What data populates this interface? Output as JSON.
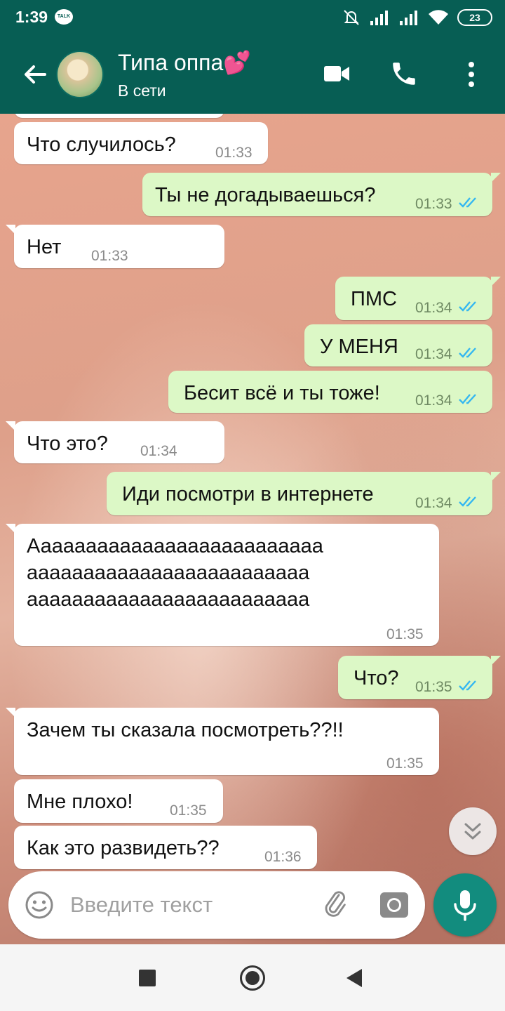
{
  "status_bar": {
    "time": "1:39",
    "talk_badge": "TALK",
    "battery": "23"
  },
  "header": {
    "contact_name": "Типа оппа💕",
    "contact_status": "В сети"
  },
  "messages": [
    {
      "dir": "in",
      "text": "Что случилось?",
      "time": "01:33"
    },
    {
      "dir": "out",
      "text": "Ты не догадываешься?",
      "time": "01:33",
      "read": true
    },
    {
      "dir": "in",
      "text": "Нет",
      "time": "01:33"
    },
    {
      "dir": "out",
      "text": "ПМС",
      "time": "01:34",
      "read": true
    },
    {
      "dir": "out",
      "text": "У МЕНЯ",
      "time": "01:34",
      "read": true
    },
    {
      "dir": "out",
      "text": "Бесит всё и ты тоже!",
      "time": "01:34",
      "read": true
    },
    {
      "dir": "in",
      "text": "Что это?",
      "time": "01:34"
    },
    {
      "dir": "out",
      "text": "Иди посмотри в интернете",
      "time": "01:34",
      "read": true
    },
    {
      "dir": "in",
      "text": "Аааааааааааааааааааааааааа\nааааааааааааааааааааааааа\nааааааааааааааааааааааааа",
      "time": "01:35"
    },
    {
      "dir": "out",
      "text": "Что?",
      "time": "01:35",
      "read": true
    },
    {
      "dir": "in",
      "text": "Зачем ты сказала посмотреть??!!",
      "time": "01:35"
    },
    {
      "dir": "in",
      "text": "Мне плохо!",
      "time": "01:35"
    },
    {
      "dir": "in",
      "text": "Как это развидеть??",
      "time": "01:36"
    }
  ],
  "input": {
    "placeholder": "Введите текст"
  },
  "colors": {
    "header": "#075e54",
    "outgoing_bubble": "#dcf8c6",
    "incoming_bubble": "#ffffff",
    "read_ticks": "#34b7f1",
    "mic_button": "#128c7e"
  },
  "icons": [
    "back-arrow-icon",
    "video-call-icon",
    "phone-icon",
    "more-vert-icon",
    "emoji-icon",
    "attach-icon",
    "camera-icon",
    "mic-icon",
    "scroll-down-icon"
  ]
}
